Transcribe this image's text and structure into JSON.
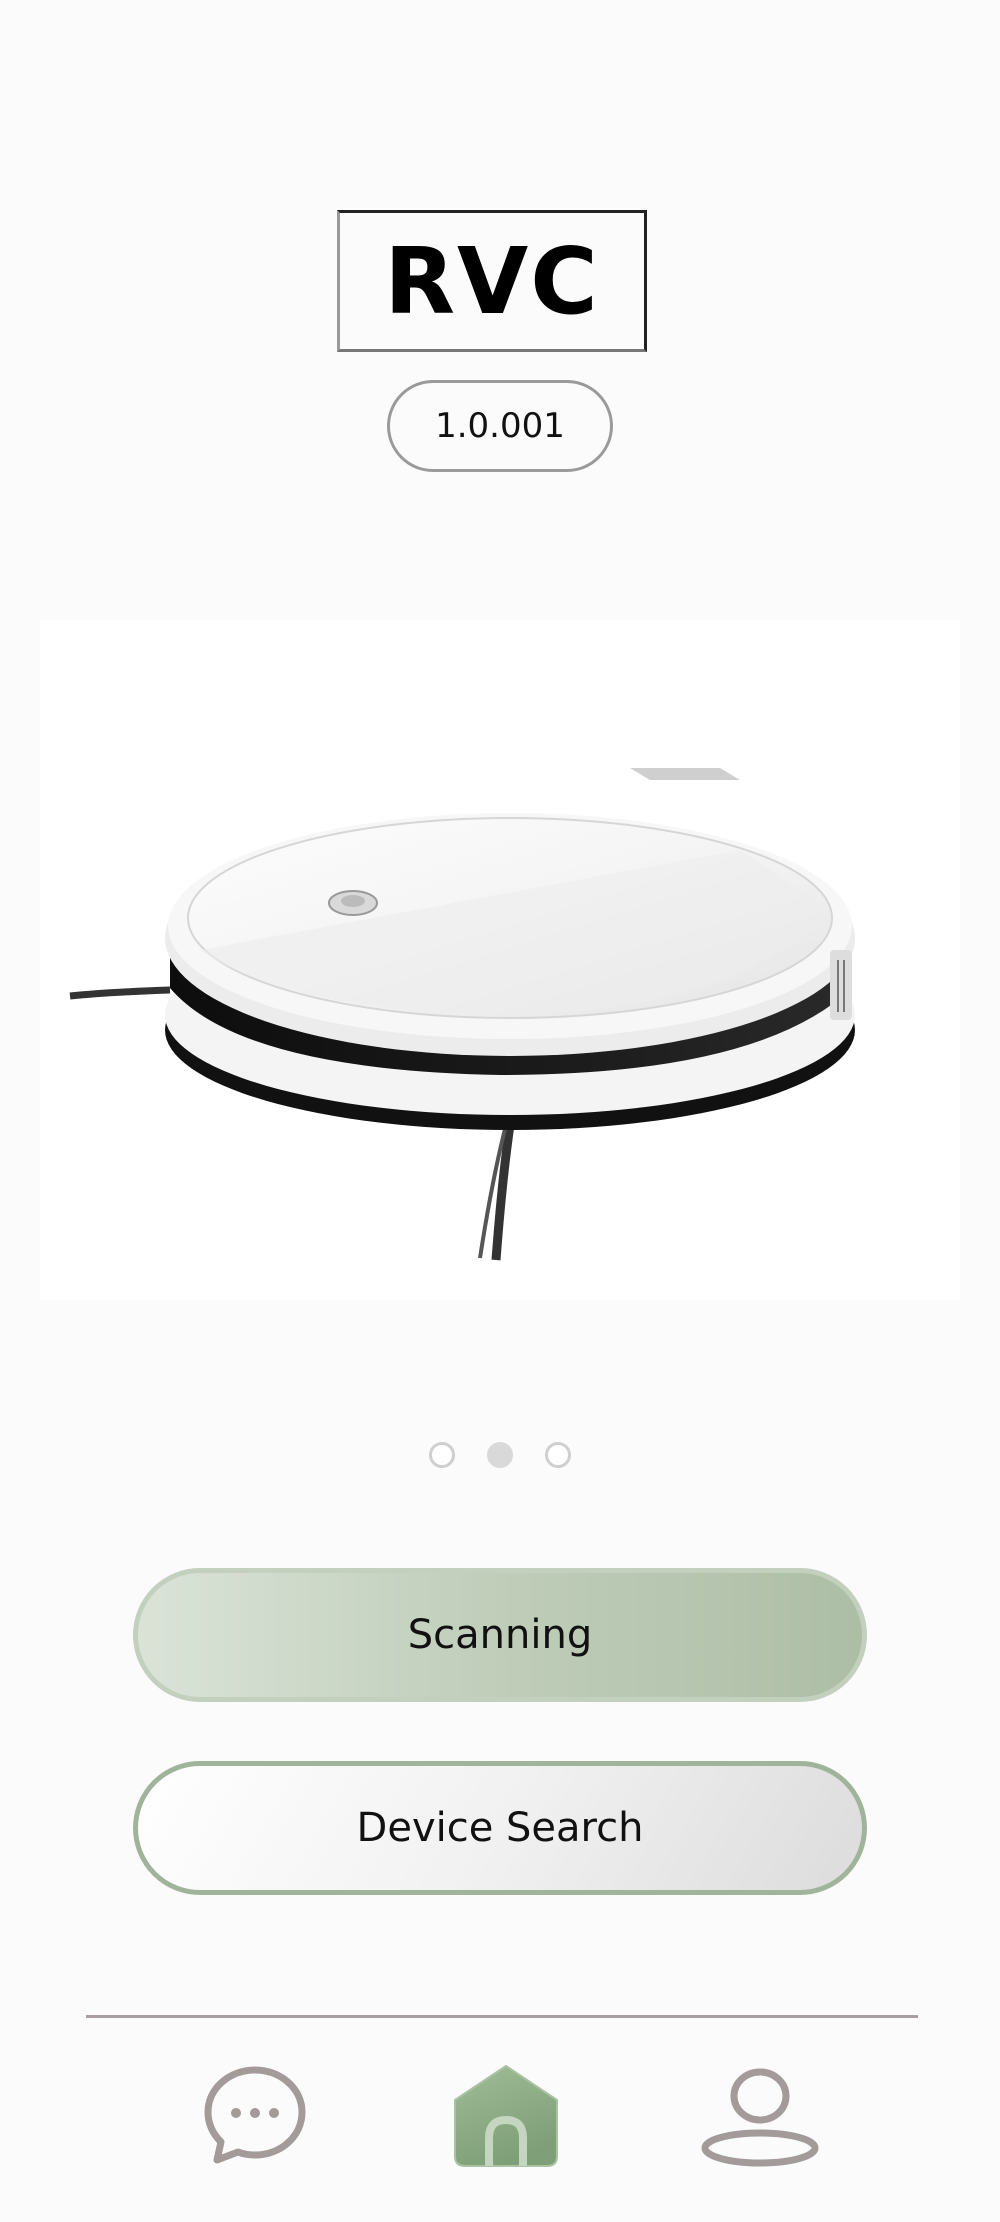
{
  "header": {
    "title": "RVC",
    "version": "1.0.001"
  },
  "carousel": {
    "image": "robot-vacuum-image",
    "pages": 3,
    "active_index": 1
  },
  "actions": {
    "scan_label": "Scanning",
    "search_label": "Device Search"
  },
  "bottom_nav": {
    "items": [
      {
        "icon": "chat-icon",
        "active": false
      },
      {
        "icon": "home-icon",
        "active": true
      },
      {
        "icon": "profile-icon",
        "active": false
      }
    ]
  },
  "colors": {
    "accent_green": "#adbea6",
    "nav_icon_gray": "#a39a9a",
    "home_active": "#8fae88"
  }
}
